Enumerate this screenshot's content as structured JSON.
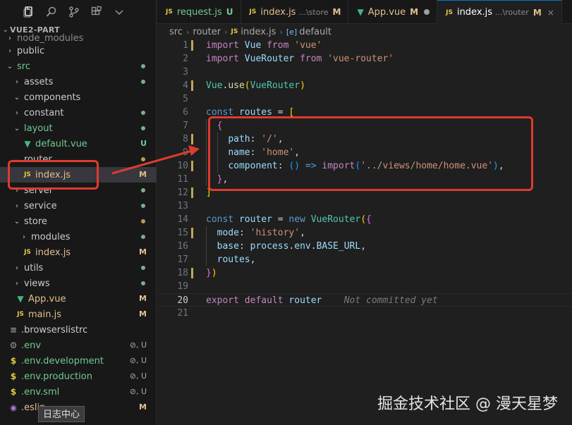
{
  "explorer": {
    "root_label": "VUE2-PART",
    "tree": [
      {
        "label": "node_modules",
        "type": "folder",
        "indent": 1,
        "expanded": false,
        "label_class": "c-dim",
        "partial": true
      },
      {
        "label": "public",
        "type": "folder",
        "indent": 1,
        "expanded": false
      },
      {
        "label": "src",
        "type": "folder",
        "indent": 1,
        "expanded": true,
        "label_class": "c-green",
        "dot": "green"
      },
      {
        "label": "assets",
        "type": "folder",
        "indent": 2,
        "expanded": false,
        "dot": "green"
      },
      {
        "label": "components",
        "type": "folder",
        "indent": 2,
        "expanded": true
      },
      {
        "label": "constant",
        "type": "folder",
        "indent": 2,
        "expanded": false,
        "dot": "green"
      },
      {
        "label": "layout",
        "type": "folder",
        "indent": 2,
        "expanded": true,
        "label_class": "c-green",
        "dot": "green"
      },
      {
        "label": "default.vue",
        "type": "vue",
        "indent": 3,
        "label_class": "c-green",
        "status": "U"
      },
      {
        "label": "router",
        "type": "folder",
        "indent": 2,
        "expanded": true,
        "dot": "yellow"
      },
      {
        "label": "index.js",
        "type": "js",
        "indent": 3,
        "label_class": "c-yellow",
        "status": "M",
        "selected": true
      },
      {
        "label": "server",
        "type": "folder",
        "indent": 2,
        "expanded": false,
        "dot": "green"
      },
      {
        "label": "service",
        "type": "folder",
        "indent": 2,
        "expanded": false,
        "dot": "green"
      },
      {
        "label": "store",
        "type": "folder",
        "indent": 2,
        "expanded": true,
        "dot": "yellow"
      },
      {
        "label": "modules",
        "type": "folder",
        "indent": 3,
        "expanded": false,
        "dot": "green"
      },
      {
        "label": "index.js",
        "type": "js",
        "indent": 3,
        "label_class": "c-yellow",
        "status": "M"
      },
      {
        "label": "utils",
        "type": "folder",
        "indent": 2,
        "expanded": false,
        "dot": "green"
      },
      {
        "label": "views",
        "type": "folder",
        "indent": 2,
        "expanded": false,
        "dot": "green"
      },
      {
        "label": "App.vue",
        "type": "vue",
        "indent": 2,
        "label_class": "c-yellow",
        "status": "M"
      },
      {
        "label": "main.js",
        "type": "js",
        "indent": 2,
        "label_class": "c-yellow",
        "status": "M"
      },
      {
        "label": ".browserslistrc",
        "type": "lines",
        "indent": 1
      },
      {
        "label": ".env",
        "type": "gear",
        "indent": 1,
        "label_class": "c-green",
        "status": "⊘, U"
      },
      {
        "label": ".env.development",
        "type": "dollar",
        "indent": 1,
        "label_class": "c-green",
        "status": "⊘, U"
      },
      {
        "label": ".env.production",
        "type": "dollar",
        "indent": 1,
        "label_class": "c-green",
        "status": "⊘, U"
      },
      {
        "label": ".env.sml",
        "type": "dollar",
        "indent": 1,
        "label_class": "c-green",
        "status": "⊘, U"
      },
      {
        "label": ".eslin",
        "type": "target",
        "indent": 1,
        "label_class": "c-yellow",
        "status": "M"
      }
    ],
    "tooltip": "日志中心"
  },
  "tabs": [
    {
      "icon": "JS",
      "icon_class": "js-icon",
      "label": "request.js",
      "status": "U",
      "status_class": "c-green",
      "label_class": "c-green"
    },
    {
      "icon": "JS",
      "icon_class": "js-icon",
      "label": "index.js",
      "desc": "...\\store",
      "status": "M",
      "status_class": "c-yellow",
      "label_class": "c-yellow"
    },
    {
      "icon": "▼",
      "icon_class": "vue-icon",
      "label": "App.vue",
      "status": "M",
      "status_class": "c-yellow",
      "label_class": "c-yellow",
      "dot": true
    },
    {
      "icon": "JS",
      "icon_class": "js-icon",
      "label": "index.js",
      "desc": "...\\router",
      "status": "M",
      "status_class": "c-yellow",
      "label_class": "c-yellow",
      "active": true,
      "close": true
    }
  ],
  "breadcrumb": {
    "parts": [
      "src",
      "router",
      "index.js",
      "default"
    ],
    "file_icon": "JS",
    "symbol_icon": "[e]"
  },
  "editor": {
    "current_line": 20,
    "lines": [
      {
        "n": 1,
        "mod": true,
        "tokens": [
          [
            "import",
            "ki"
          ],
          [
            " Vue ",
            "v"
          ],
          [
            "from",
            "ki"
          ],
          [
            " ",
            "p"
          ],
          [
            "'vue'",
            "s"
          ]
        ]
      },
      {
        "n": 2,
        "mod": false,
        "tokens": [
          [
            "import",
            "ki"
          ],
          [
            " VueRouter ",
            "v"
          ],
          [
            "from",
            "ki"
          ],
          [
            " ",
            "p"
          ],
          [
            "'vue-router'",
            "s"
          ]
        ]
      },
      {
        "n": 3,
        "mod": false,
        "tokens": []
      },
      {
        "n": 4,
        "mod": true,
        "tokens": [
          [
            "Vue",
            "cls"
          ],
          [
            ".",
            "p"
          ],
          [
            "use",
            "f"
          ],
          [
            "(",
            "b1"
          ],
          [
            "VueRouter",
            "cls"
          ],
          [
            ")",
            "b1"
          ]
        ]
      },
      {
        "n": 5,
        "mod": false,
        "tokens": []
      },
      {
        "n": 6,
        "mod": false,
        "tokens": [
          [
            "const",
            "k"
          ],
          [
            " routes ",
            "v"
          ],
          [
            "=",
            "p"
          ],
          [
            " ",
            "p"
          ],
          [
            "[",
            "b1"
          ]
        ]
      },
      {
        "n": 7,
        "mod": false,
        "tokens": [
          [
            "  ",
            "p"
          ],
          [
            "{",
            "b2"
          ]
        ]
      },
      {
        "n": 8,
        "mod": true,
        "tokens": [
          [
            "    ",
            "p"
          ],
          [
            "path",
            "v"
          ],
          [
            ": ",
            "p"
          ],
          [
            "'/'",
            "s"
          ],
          [
            ",",
            "p"
          ]
        ]
      },
      {
        "n": 9,
        "mod": false,
        "tokens": [
          [
            "    ",
            "p"
          ],
          [
            "name",
            "v"
          ],
          [
            ": ",
            "p"
          ],
          [
            "'home'",
            "s"
          ],
          [
            ",",
            "p"
          ]
        ]
      },
      {
        "n": 10,
        "mod": true,
        "tokens": [
          [
            "    ",
            "p"
          ],
          [
            "component",
            "v"
          ],
          [
            ": ",
            "p"
          ],
          [
            "()",
            "b3"
          ],
          [
            " ",
            "p"
          ],
          [
            "=>",
            "k"
          ],
          [
            " ",
            "p"
          ],
          [
            "import",
            "ki"
          ],
          [
            "(",
            "b3"
          ],
          [
            "'../views/home/home.vue'",
            "s"
          ],
          [
            ")",
            "b3"
          ],
          [
            ",",
            "p"
          ]
        ]
      },
      {
        "n": 11,
        "mod": false,
        "tokens": [
          [
            "  ",
            "p"
          ],
          [
            "}",
            "b2"
          ],
          [
            ",",
            "p"
          ]
        ]
      },
      {
        "n": 12,
        "mod": true,
        "tokens": [
          [
            "]",
            "b1"
          ]
        ]
      },
      {
        "n": 13,
        "mod": false,
        "tokens": []
      },
      {
        "n": 14,
        "mod": false,
        "tokens": [
          [
            "const",
            "k"
          ],
          [
            " router ",
            "v"
          ],
          [
            "=",
            "p"
          ],
          [
            " ",
            "p"
          ],
          [
            "new",
            "k"
          ],
          [
            " ",
            "p"
          ],
          [
            "VueRouter",
            "cls"
          ],
          [
            "(",
            "b1"
          ],
          [
            "{",
            "b2"
          ]
        ]
      },
      {
        "n": 15,
        "mod": true,
        "tokens": [
          [
            "  ",
            "p"
          ],
          [
            "mode",
            "v"
          ],
          [
            ": ",
            "p"
          ],
          [
            "'history'",
            "s"
          ],
          [
            ",",
            "p"
          ]
        ]
      },
      {
        "n": 16,
        "mod": false,
        "tokens": [
          [
            "  ",
            "p"
          ],
          [
            "base",
            "v"
          ],
          [
            ": ",
            "p"
          ],
          [
            "process",
            "v"
          ],
          [
            ".",
            "p"
          ],
          [
            "env",
            "v"
          ],
          [
            ".",
            "p"
          ],
          [
            "BASE_URL",
            "v"
          ],
          [
            ",",
            "p"
          ]
        ]
      },
      {
        "n": 17,
        "mod": false,
        "tokens": [
          [
            "  ",
            "p"
          ],
          [
            "routes",
            "v"
          ],
          [
            ",",
            "p"
          ]
        ]
      },
      {
        "n": 18,
        "mod": true,
        "tokens": [
          [
            "}",
            "b2"
          ],
          [
            ")",
            "b1"
          ]
        ]
      },
      {
        "n": 19,
        "mod": false,
        "tokens": []
      },
      {
        "n": 20,
        "mod": false,
        "tokens": [
          [
            "export",
            "ki"
          ],
          [
            " ",
            "p"
          ],
          [
            "default",
            "ki"
          ],
          [
            " router",
            "v"
          ],
          [
            "    ",
            "p"
          ],
          [
            "Not committed yet",
            "cm"
          ]
        ]
      },
      {
        "n": 21,
        "mod": false,
        "tokens": []
      }
    ]
  },
  "watermark": "掘金技术社区 @ 漫天星梦",
  "colors": {
    "annotation_red": "#e03a2f",
    "accent": "#0078d4"
  }
}
